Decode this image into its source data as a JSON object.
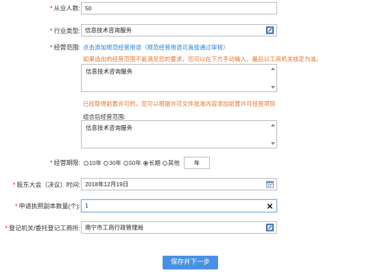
{
  "employees": {
    "label": "从业人数:",
    "value": "50"
  },
  "industry": {
    "label": "行业类型:",
    "value": "信息技术咨询服务",
    "icon": "edit-icon"
  },
  "scope": {
    "label": "经营范围:",
    "add_link": "点击添加规范经营用语（规范经营用语可直接通过审核）",
    "warning": "如果选出的经营范围不能满足您的要求，您可以在下方手动输入，最后以工商机关核定为准。",
    "text": "信息技术咨询服务",
    "license_note": "已经取得前置许可的，您可以根据许可文件批准内容添加前置许可经营项目",
    "combined_label": "组合后经营范围:",
    "combined_text": "信息技术咨询服务"
  },
  "period": {
    "label": "经营期限:",
    "options": [
      "10年",
      "30年",
      "50年",
      "长期",
      "其他"
    ],
    "selected": "长期",
    "years_unit": "年",
    "years_value": ""
  },
  "meeting_time": {
    "label": "股东大会（决议）时间:",
    "value": "2018年12月19日",
    "icon": "calendar-icon"
  },
  "copies": {
    "label": "申请执照副本数量(个):",
    "value": "1",
    "icon": "clear-icon"
  },
  "authority": {
    "label": "登记机关/委托登记工商所:",
    "value": "南宁市工商行政管理局",
    "icon": "edit-icon"
  },
  "submit": {
    "label": "保存并下一步"
  },
  "colors": {
    "required": "#e60012",
    "link": "#1e7fd8",
    "warning": "#e8742a",
    "button": "#4a90e2"
  }
}
